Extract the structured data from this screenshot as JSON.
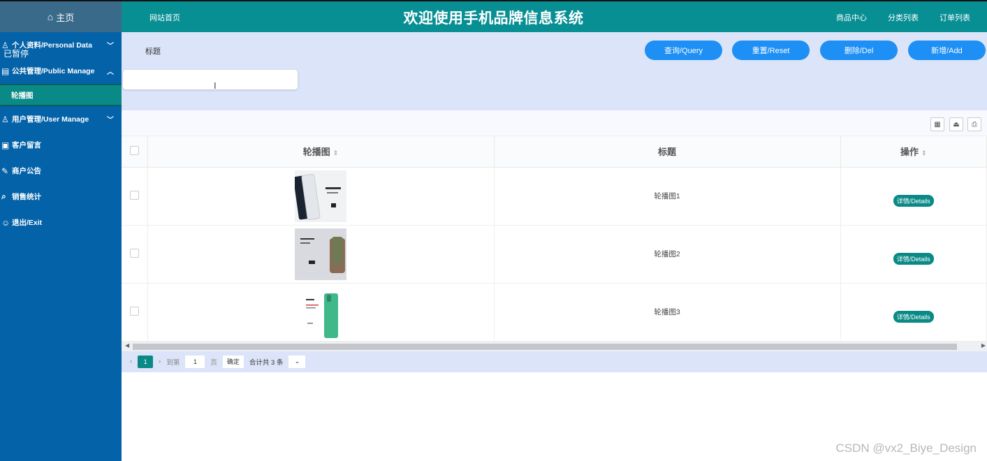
{
  "header": {
    "home": "主页",
    "site_home": "网站首页",
    "title": "欢迎使用手机品牌信息系统",
    "links": [
      "商品中心",
      "分类列表",
      "订单列表"
    ]
  },
  "overlay": {
    "paused": "已暂停"
  },
  "sidebar": {
    "items": [
      {
        "label": "个人资料/Personal Data",
        "icon": "user-icon"
      },
      {
        "label": "公共管理/Public Manage",
        "icon": "board-icon"
      },
      {
        "label": "轮播图",
        "icon": ""
      },
      {
        "label": "用户管理/User Manage",
        "icon": "user-icon"
      },
      {
        "label": "客户留言",
        "icon": "message-icon"
      },
      {
        "label": "商户公告",
        "icon": "notice-icon"
      },
      {
        "label": "销售统计",
        "icon": "chart-icon"
      },
      {
        "label": "退出/Exit",
        "icon": "exit-icon"
      }
    ]
  },
  "search": {
    "label": "标题",
    "value": "",
    "buttons": {
      "query": "查询/Query",
      "reset": "重置/Reset",
      "delete": "删除/Del",
      "add": "新增/Add"
    }
  },
  "table": {
    "headers": {
      "image": "轮播图",
      "title": "标题",
      "action": "操作"
    },
    "rows": [
      {
        "title": "轮播图1",
        "action": "详情/Details"
      },
      {
        "title": "轮播图2",
        "action": "详情/Details"
      },
      {
        "title": "轮播图3",
        "action": "详情/Details"
      }
    ]
  },
  "pager": {
    "current": "1",
    "goto_prefix": "到第",
    "goto_value": "1",
    "goto_suffix": "页",
    "confirm": "确定",
    "total": "合计共 3 条"
  },
  "watermark": "CSDN @vx2_Biye_Design",
  "colors": {
    "header": "#088f94",
    "sidebar": "#0462a8",
    "accent": "#1e8ff5",
    "teal": "#0a8a86",
    "panel": "#dbe4f8"
  }
}
